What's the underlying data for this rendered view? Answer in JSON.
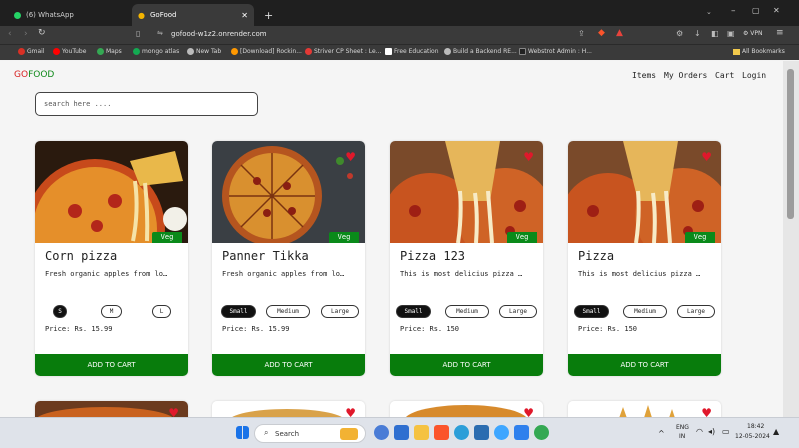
{
  "browser": {
    "tabs": [
      {
        "title": "(6) WhatsApp"
      },
      {
        "title": "GoFood"
      }
    ],
    "new_tab": "+",
    "url": "gofood-w1z2.onrender.com",
    "vpn_label": "VPN",
    "bookmarks": [
      {
        "label": "Gmail",
        "color": "#d93025"
      },
      {
        "label": "YouTube",
        "color": "#ff0000"
      },
      {
        "label": "Maps",
        "color": "#34a853"
      },
      {
        "label": "mongo atlas",
        "color": "#13aa52"
      },
      {
        "label": "New Tab",
        "color": "#bbbbbb"
      },
      {
        "label": "[Download] Rockin...",
        "color": "#ff9800"
      },
      {
        "label": "Striver CP Sheet : Le...",
        "color": "#e53935"
      },
      {
        "label": "Free Education",
        "color": "#ffffff"
      },
      {
        "label": "Build a Backend RE...",
        "color": "#bbbbbb"
      },
      {
        "label": "Webstrot Admin : H...",
        "color": "#222222"
      }
    ],
    "all_bookmarks": "All Bookmarks"
  },
  "app": {
    "brand_go": "GO",
    "brand_food": "FOOD",
    "brand_colors": {
      "go": "#d71f1f",
      "food": "#0f8a1a"
    },
    "nav": [
      "Items",
      "My Orders",
      "Cart",
      "Login"
    ],
    "search_placeholder": "search here ....",
    "accent": "#087c0c",
    "cards": [
      {
        "title": "Corn pizza",
        "desc": "Fresh organic apples from lo…",
        "sizes": [
          "S",
          "M",
          "L"
        ],
        "selected": 0,
        "price": "Price: Rs. 15.99",
        "badge": "Veg",
        "cart": "ADD TO CART"
      },
      {
        "title": "Panner Tikka",
        "desc": "Fresh organic apples from lo…",
        "sizes": [
          "Small",
          "Medium",
          "Large"
        ],
        "selected": 0,
        "price": "Price: Rs. 15.99",
        "badge": "Veg",
        "cart": "ADD TO CART"
      },
      {
        "title": "Pizza 123",
        "desc": "This is most delicius pizza …",
        "sizes": [
          "Small",
          "Medium",
          "Large"
        ],
        "selected": 0,
        "price": "Price: Rs. 150",
        "badge": "Veg",
        "cart": "ADD TO CART"
      },
      {
        "title": "Pizza",
        "desc": "This is most delicius pizza …",
        "sizes": [
          "Small",
          "Medium",
          "Large"
        ],
        "selected": 0,
        "price": "Price: Rs. 150",
        "badge": "Veg",
        "cart": "ADD TO CART"
      }
    ]
  },
  "taskbar": {
    "search_label": "Search",
    "lang_top": "ENG",
    "lang_bottom": "IN",
    "time": "18:42",
    "date": "12-05-2024"
  }
}
